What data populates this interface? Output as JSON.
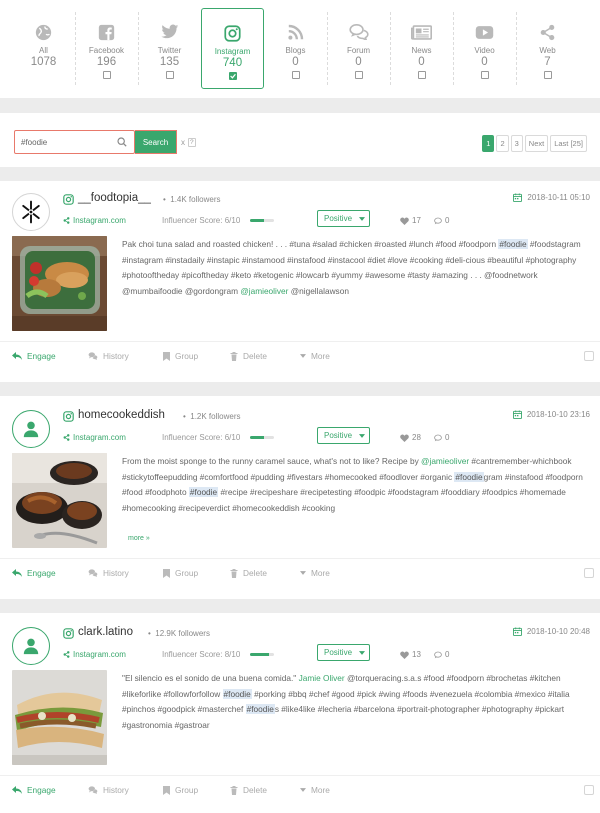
{
  "sources": [
    {
      "name": "All",
      "count": "1078",
      "icon": "globe-icon",
      "active": false
    },
    {
      "name": "Facebook",
      "count": "196",
      "icon": "facebook-icon",
      "active": false
    },
    {
      "name": "Twitter",
      "count": "135",
      "icon": "twitter-icon",
      "active": false
    },
    {
      "name": "Instagram",
      "count": "740",
      "icon": "instagram-icon",
      "active": true
    },
    {
      "name": "Blogs",
      "count": "0",
      "icon": "rss-icon",
      "active": false
    },
    {
      "name": "Forum",
      "count": "0",
      "icon": "forum-icon",
      "active": false
    },
    {
      "name": "News",
      "count": "0",
      "icon": "news-icon",
      "active": false
    },
    {
      "name": "Video",
      "count": "0",
      "icon": "youtube-icon",
      "active": false
    },
    {
      "name": "Web",
      "count": "7",
      "icon": "share-icon",
      "active": false
    }
  ],
  "search": {
    "value": "#foodie",
    "button": "Search",
    "clear": "x",
    "help": "?"
  },
  "pagination": {
    "pages": [
      "1",
      "2",
      "3"
    ],
    "next": "Next",
    "last": "Last [25]",
    "current": "1"
  },
  "colors": {
    "accent": "#3aa76d",
    "highlight": "#dde8f4",
    "search_border": "#e8796b"
  },
  "actions": {
    "engage": "Engage",
    "history": "History",
    "group": "Group",
    "delete": "Delete",
    "more": "More"
  },
  "posts": [
    {
      "username": "__foodtopia__",
      "followers": "1.4K  followers",
      "source": "Instagram.com",
      "score_label": "Influencer Score: 6/10",
      "score": 0.6,
      "sentiment": "Positive",
      "likes": "17",
      "comments": "0",
      "date": "2018-10-11 05:10",
      "more": ""
    },
    {
      "username": "homecookeddish",
      "followers": "1.2K  followers",
      "source": "Instagram.com",
      "score_label": "Influencer Score: 6/10",
      "score": 0.6,
      "sentiment": "Positive",
      "likes": "28",
      "comments": "0",
      "date": "2018-10-10 23:16",
      "more": "more »"
    },
    {
      "username": "clark.latino",
      "followers": "12.9K  followers",
      "source": "Instagram.com",
      "score_label": "Influencer Score: 8/10",
      "score": 0.8,
      "sentiment": "Positive",
      "likes": "13",
      "comments": "0",
      "date": "2018-10-10 20:48",
      "more": ""
    }
  ],
  "post_texts": [
    [
      {
        "t": "Pak choi tuna salad and roasted chicken! . . . #tuna #salad #chicken #roasted #lunch #food #foodporn "
      },
      {
        "t": "#foodie",
        "c": "hl"
      },
      {
        "t": " #foodstagram #instagram #instadaily #instapic #instamood #instafood #instacool #diet #love #cooking #deli-cious #beautiful #photography #photooftheday #picoftheday #keto #ketogenic #lowcarb #yummy #awesome #tasty #amazing . . . @foodnetwork @mumbaifoodie @gordongram "
      },
      {
        "t": "@jamieoliver",
        "c": "mention"
      },
      {
        "t": " @nigellalawson"
      }
    ],
    [
      {
        "t": "From the moist sponge to the runny caramel sauce, what's not to like? Recipe by "
      },
      {
        "t": "@jamieoliver",
        "c": "mention"
      },
      {
        "t": " #cantremember-whichbook #stickytoffeepudding #comfortfood #pudding #fivestars #homecooked #foodlover #organic "
      },
      {
        "t": "#foodie",
        "c": "hl"
      },
      {
        "t": "gram #instafood #foodporn #food #foodphoto "
      },
      {
        "t": "#foodie",
        "c": "hl"
      },
      {
        "t": " #recipe #recipeshare #recipetesting #foodpic #foodstagram #fooddiary #foodpics #homemade #homecooking #recipeverdict #homecookeddish #cooking"
      }
    ],
    [
      {
        "t": "\"El silencio es el sonido de una buena comida.\" "
      },
      {
        "t": "Jamie Oliver",
        "c": "mention"
      },
      {
        "t": " @torqueracing.s.a.s #food #foodporn #brochetas #kitchen #likeforlike #followforfollow "
      },
      {
        "t": "#foodie",
        "c": "hl"
      },
      {
        "t": " #porking #bbq #chef #good #pick #wing #foods #venezuela #colombia #mexico #italia #pinchos #goodpick #masterchef "
      },
      {
        "t": "#foodie",
        "c": "hl"
      },
      {
        "t": "s #like4like #lecheria #barcelona #portrait-photographer #photography #pickart #gastronomia #gastroar"
      }
    ]
  ]
}
